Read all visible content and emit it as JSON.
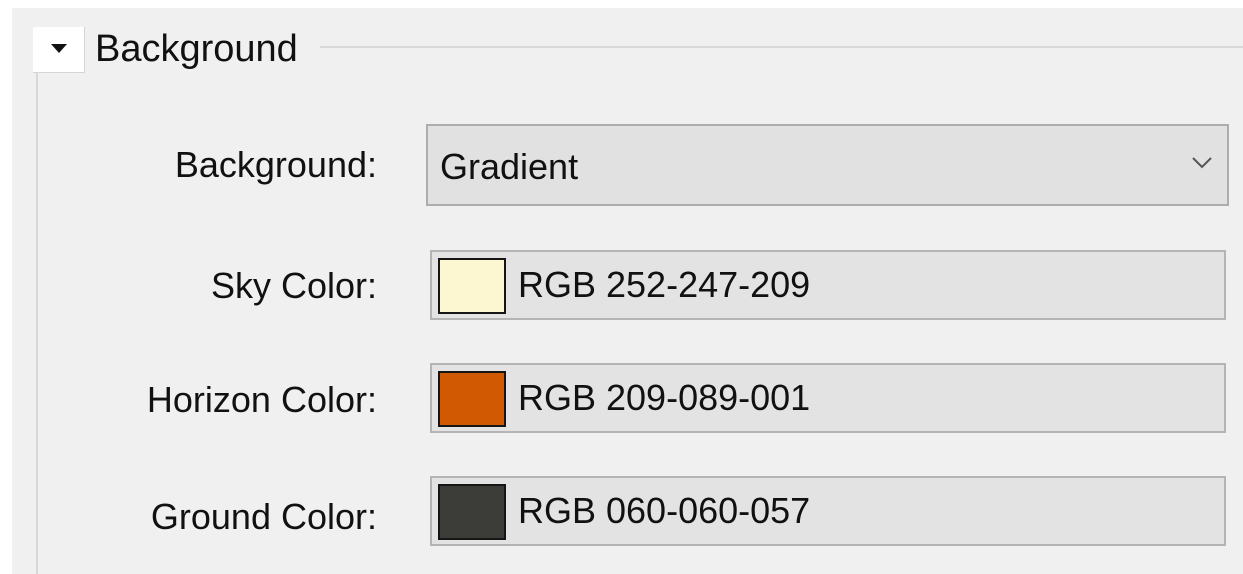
{
  "section": {
    "title": "Background",
    "expanded": true
  },
  "background_mode": {
    "label": "Background:",
    "value": "Gradient"
  },
  "sky_color": {
    "label": "Sky Color:",
    "value": "RGB 252-247-209",
    "hex": "#fcf7d1"
  },
  "horizon_color": {
    "label": "Horizon Color:",
    "value": "RGB 209-089-001",
    "hex": "#d15901"
  },
  "ground_color": {
    "label": "Ground Color:",
    "value": "RGB 060-060-057",
    "hex": "#3c3c39"
  },
  "icons": {
    "collapse": "triangle-down-icon",
    "dropdown": "chevron-down-icon"
  },
  "theme": {
    "panel_bg": "#f0f0f0",
    "field_bg": "#e3e3e3",
    "border": "#adadad"
  }
}
